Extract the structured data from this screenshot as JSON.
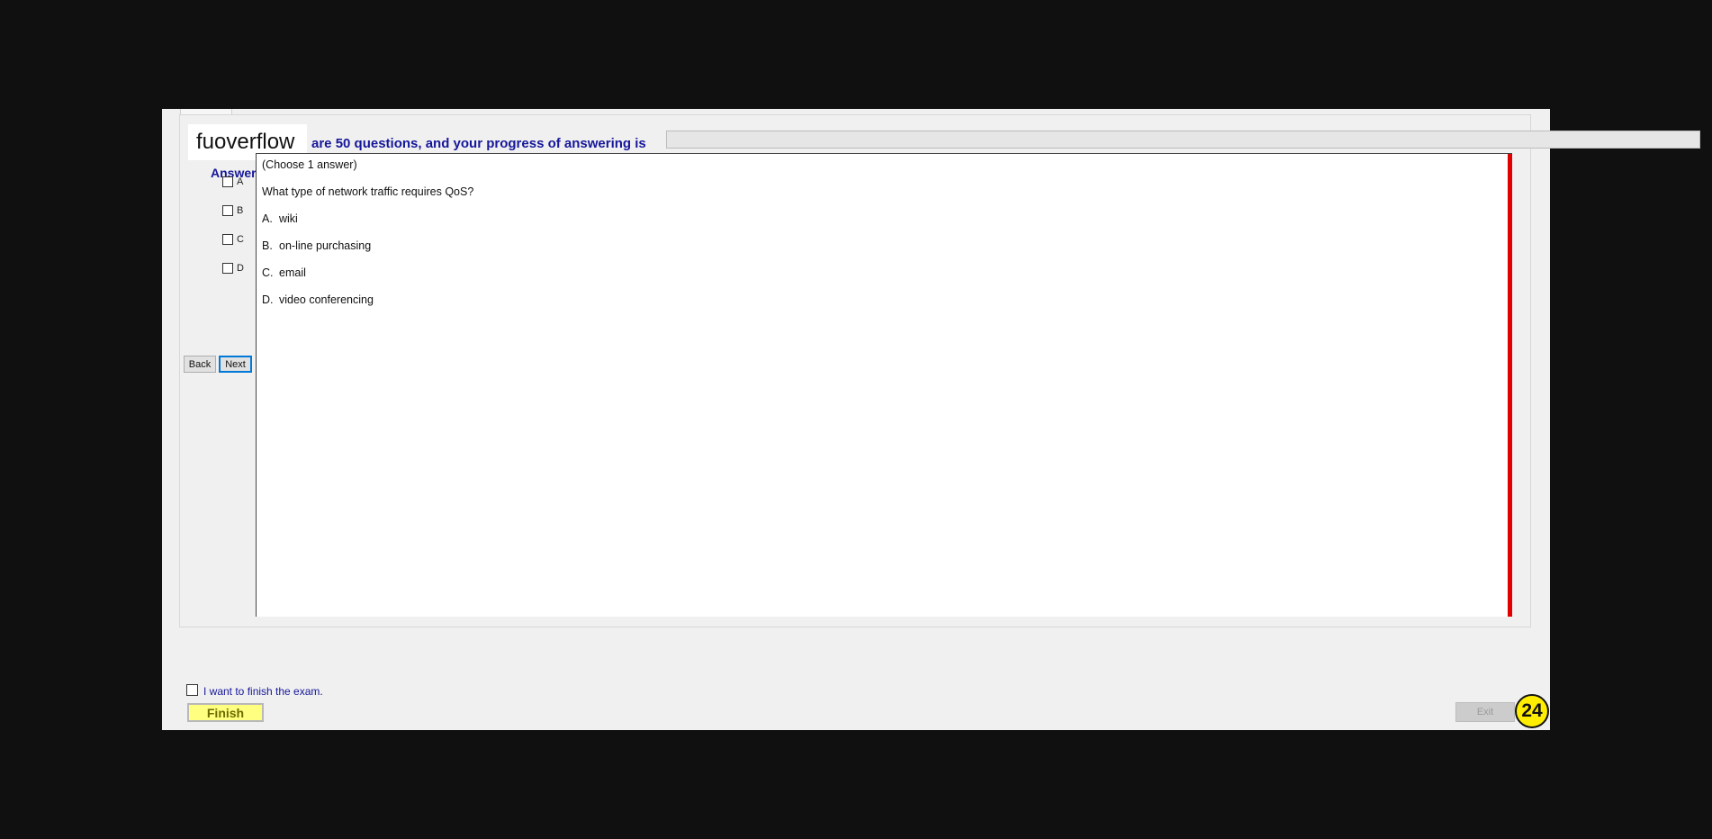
{
  "logo": "fuoverflow",
  "header": {
    "progress_text": "are 50 questions, and your progress of answering is",
    "progress_fraction": 0
  },
  "answer_panel": {
    "title": "Answer",
    "options": [
      "A",
      "B",
      "C",
      "D"
    ],
    "back_label": "Back",
    "next_label": "Next"
  },
  "question": {
    "instruction": "(Choose 1 answer)",
    "text": "What type of network traffic requires QoS?",
    "choices": [
      {
        "letter": "A.",
        "text": "wiki"
      },
      {
        "letter": "B.",
        "text": "on-line purchasing"
      },
      {
        "letter": "C.",
        "text": "email"
      },
      {
        "letter": "D.",
        "text": "video conferencing"
      }
    ]
  },
  "footer": {
    "finish_checkbox_label": "I want to finish the exam.",
    "finish_label": "Finish",
    "exit_label": "Exit",
    "badge": "24"
  },
  "colors": {
    "accent_text": "#16179a",
    "scroll_marker": "#e00000",
    "finish_button": "#ffff80",
    "badge": "#ffee00"
  }
}
